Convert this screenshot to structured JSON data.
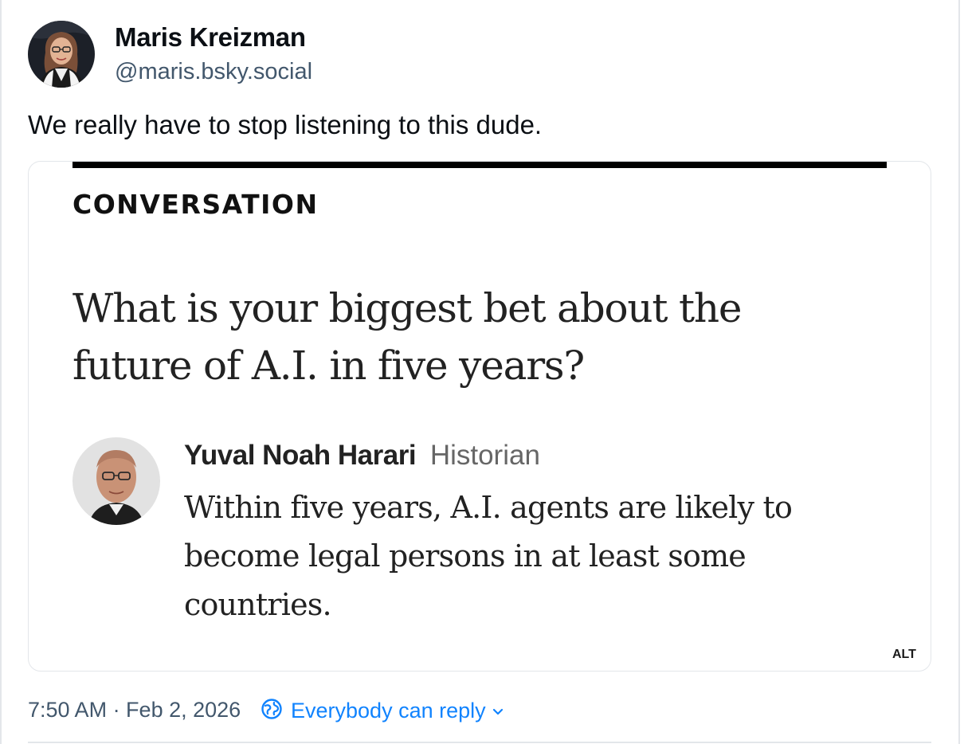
{
  "post": {
    "author": {
      "display_name": "Maris Kreizman",
      "handle": "@maris.bsky.social"
    },
    "text": "We really have to stop listening to this dude.",
    "timestamp": "7:50 AM · Feb 2, 2026",
    "reply_setting": "Everybody can reply"
  },
  "embed_image": {
    "kicker": "CONVERSATION",
    "question": "What is your biggest bet about the future of A.I. in five years?",
    "respondent_name": "Yuval Noah Harari",
    "respondent_role": "Historian",
    "answer": "Within five years, A.I. agents are likely to become legal persons in at least some countries.",
    "alt_badge": "ALT"
  },
  "colors": {
    "accent_blue": "#1083fe",
    "muted_text": "#42576c",
    "border": "#e3e6ea"
  },
  "icons": [
    "globe-reply-icon",
    "chevron-down-icon"
  ]
}
